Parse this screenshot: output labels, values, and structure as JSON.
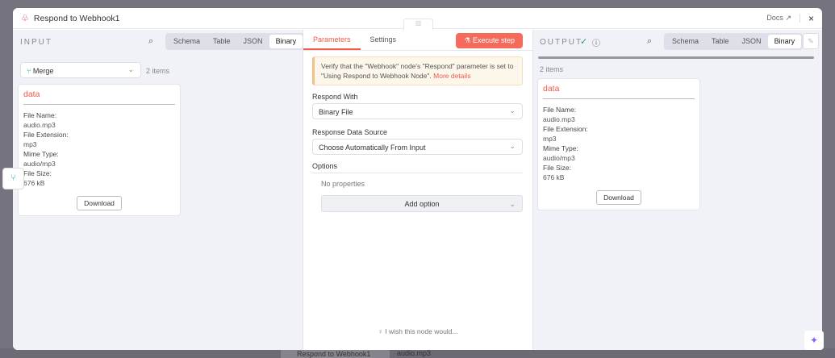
{
  "header": {
    "title": "Respond to Webhook1",
    "docs_label": "Docs",
    "close_label": "×"
  },
  "input": {
    "label": "INPUT",
    "tabs": [
      "Schema",
      "Table",
      "JSON",
      "Binary"
    ],
    "active_tab": "Binary",
    "node_select": "Merge",
    "item_count": "2 items",
    "card": {
      "key": "data",
      "fields": [
        {
          "label": "File Name:",
          "value": "audio.mp3"
        },
        {
          "label": "File Extension:",
          "value": "mp3"
        },
        {
          "label": "Mime Type:",
          "value": "audio/mp3"
        },
        {
          "label": "File Size:",
          "value": "676 kB"
        }
      ],
      "download_label": "Download"
    }
  },
  "params": {
    "tabs": [
      "Parameters",
      "Settings"
    ],
    "active_tab": "Parameters",
    "execute_label": "Execute step",
    "notice_text": "Verify that the \"Webhook\" node's \"Respond\" parameter is set to \"Using Respond to Webhook Node\".",
    "notice_link": "More details",
    "respond_with_label": "Respond With",
    "respond_with_value": "Binary File",
    "data_source_label": "Response Data Source",
    "data_source_value": "Choose Automatically From Input",
    "options_label": "Options",
    "no_properties": "No properties",
    "add_option_label": "Add option",
    "wish_text": "I wish this node would..."
  },
  "output": {
    "label": "OUTPUT",
    "tabs": [
      "Schema",
      "Table",
      "JSON",
      "Binary"
    ],
    "active_tab": "Binary",
    "item_count": "2 items",
    "card": {
      "key": "data",
      "fields": [
        {
          "label": "File Name:",
          "value": "audio.mp3"
        },
        {
          "label": "File Extension:",
          "value": "mp3"
        },
        {
          "label": "Mime Type:",
          "value": "audio/mp3"
        },
        {
          "label": "File Size:",
          "value": "676 kB"
        }
      ],
      "download_label": "Download"
    }
  },
  "background": {
    "node_label": "Respond to Webhook1",
    "file_label": "audio.mp3"
  },
  "colors": {
    "accent": "#f56a5b",
    "success": "#22a06b",
    "merge_icon": "#35a2c0",
    "ai": "#8b5cf6"
  }
}
